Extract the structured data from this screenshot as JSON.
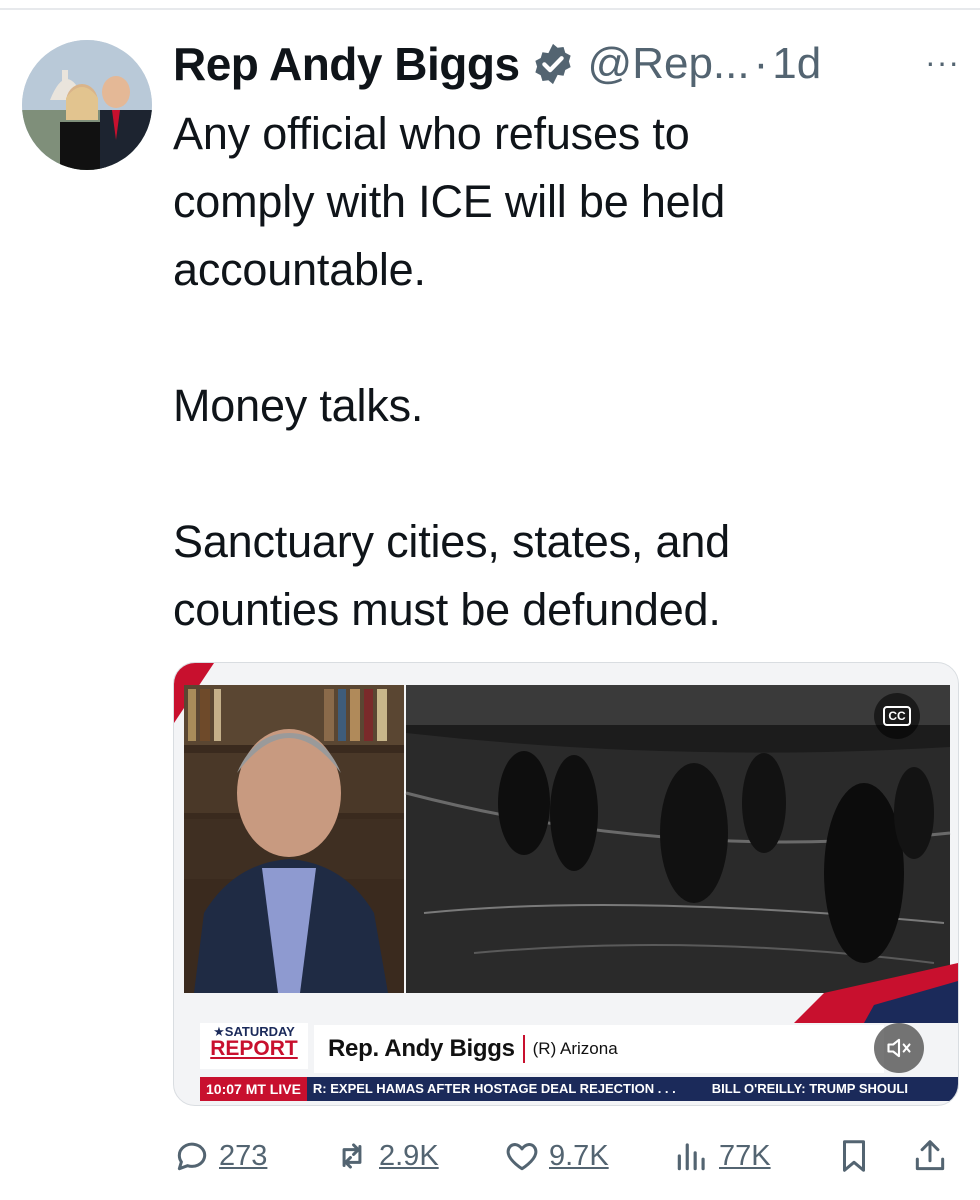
{
  "tweet": {
    "author_name": "Rep Andy Biggs",
    "handle": "@Rep...",
    "separator": "·",
    "time": "1d",
    "more_label": "···",
    "text": "Any official who refuses to\ncomply with ICE will be held\naccountable.\n\nMoney talks.\n\nSanctuary cities, states, and\ncounties must be defunded."
  },
  "media": {
    "cc_label": "CC",
    "brand_top": "★SATURDAY",
    "brand_bottom": "REPORT",
    "lower_third_name": "Rep. Andy Biggs",
    "lower_third_party": "(R) Arizona",
    "ticker_time": "10:07 MT  LIVE",
    "ticker_text_1": "R: EXPEL HAMAS AFTER HOSTAGE DEAL REJECTION . . .",
    "ticker_text_2": "BILL O'REILLY: TRUMP SHOULI"
  },
  "actions": {
    "replies": "273",
    "reposts": "2.9K",
    "likes": "9.7K",
    "views": "77K"
  },
  "colors": {
    "text": "#0f1419",
    "muted": "#536471",
    "verified": "#536471",
    "news_red": "#c8102e",
    "news_navy": "#1b2a5a"
  },
  "icons": [
    "verified-badge-icon",
    "more-icon",
    "cc-icon",
    "mute-icon",
    "reply-icon",
    "repost-icon",
    "like-icon",
    "views-icon",
    "bookmark-icon",
    "share-icon"
  ]
}
